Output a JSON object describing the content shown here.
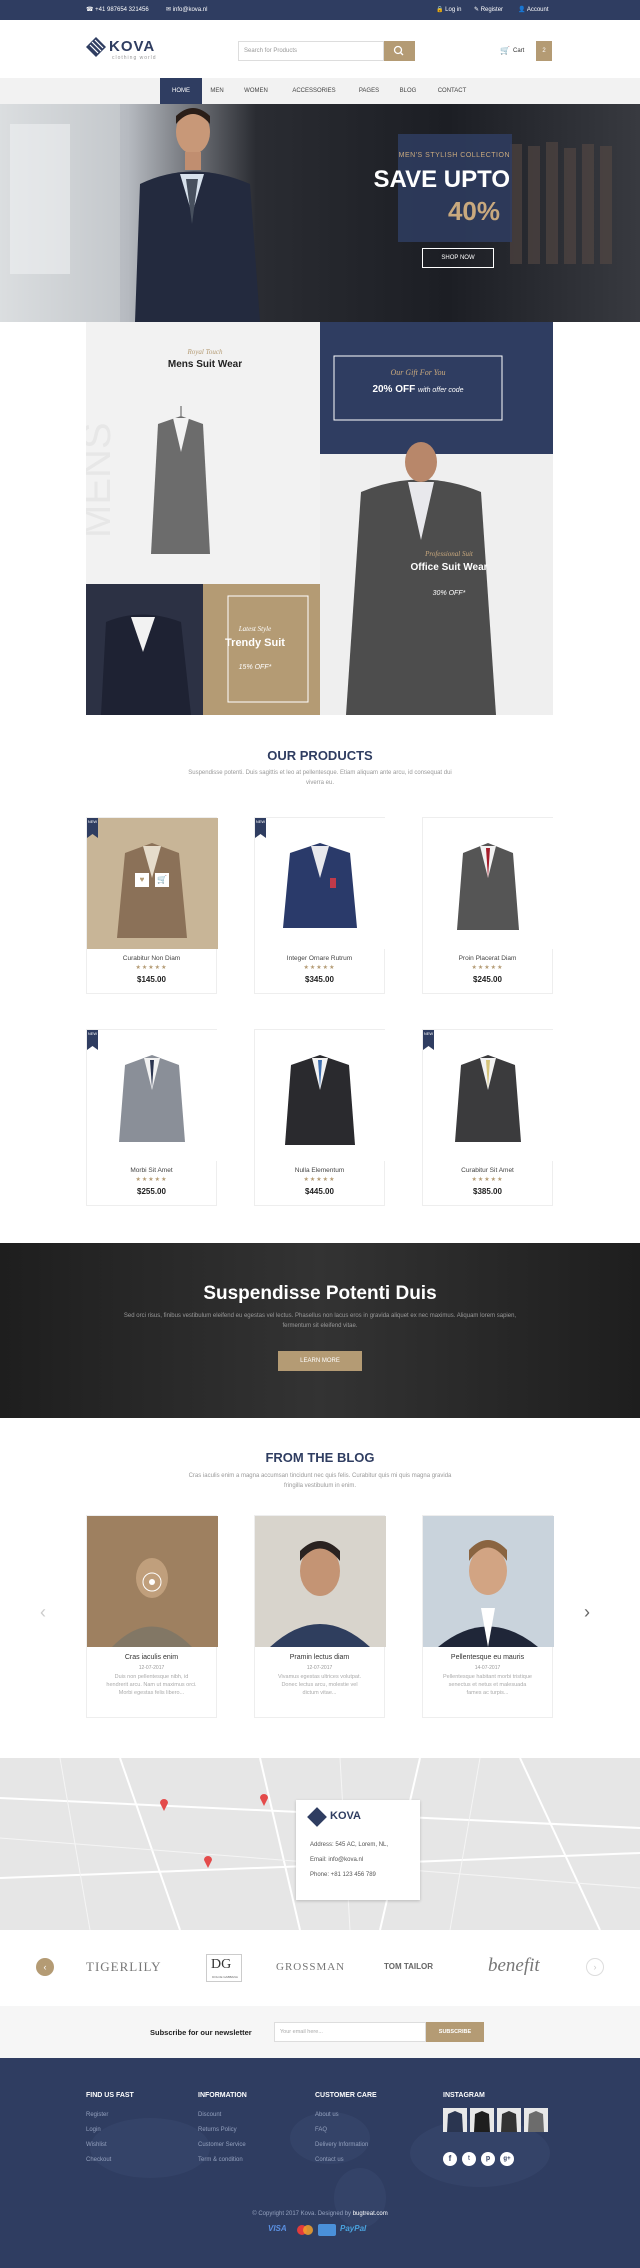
{
  "topbar": {
    "phone": "+41 987654 321456",
    "email": "info@kova.nl",
    "login": "Log in",
    "register": "Register",
    "account": "Account"
  },
  "header": {
    "logo": "KOVA",
    "logo_tag": "clothing world",
    "search_placeholder": "Search for Products",
    "cart_label": "Cart",
    "cart_count": "2"
  },
  "nav": [
    "HOME",
    "MEN",
    "WOMEN",
    "ACCESSORIES",
    "PAGES",
    "BLOG",
    "CONTACT"
  ],
  "hero": {
    "eyebrow": "MEN'S STYLISH COLLECTION",
    "title": "SAVE UPTO",
    "percent": "40%",
    "button": "SHOP NOW"
  },
  "promo": {
    "royal_script": "Royal Touch",
    "royal_title": "Mens Suit Wear",
    "gift_script": "Our Gift For You",
    "gift_off": "20% OFF",
    "gift_rest": "with offer code",
    "pro_script": "Professional Suit",
    "pro_title": "Office Suit Wear",
    "pro_off": "30% OFF*",
    "latest_script": "Latest Style",
    "latest_title": "Trendy Suit",
    "latest_off": "15% OFF*"
  },
  "products": {
    "title": "OUR PRODUCTS",
    "subtitle": "Suspendisse potenti. Duis sagittis et leo at pellentesque. Etiam aliquam ante arcu, id consequat dui viverra eu.",
    "ribbon": "NEW",
    "items": [
      {
        "name": "Curabitur Non Diam",
        "stars": "★★★★★",
        "price": "$145.00"
      },
      {
        "name": "Integer Ornare Rutrum",
        "stars": "★★★★★",
        "price": "$345.00"
      },
      {
        "name": "Proin Placerat Diam",
        "stars": "★★★★★",
        "price": "$245.00"
      },
      {
        "name": "Morbi Sit Amet",
        "stars": "★★★★★",
        "price": "$255.00"
      },
      {
        "name": "Nulla Elementum",
        "stars": "★★★★★",
        "price": "$445.00"
      },
      {
        "name": "Curabitur Sit Amet",
        "stars": "★★★★★",
        "price": "$385.00"
      }
    ]
  },
  "banner": {
    "title": "Suspendisse Potenti Duis",
    "text": "Sed orci risus, finibus vestibulum eleifend eu egestas vel lectus. Phasellus non lacus eros in gravida aliquet ex nec maximus. Aliquam lorem sapien, fermentum sit eleifend vitae.",
    "button": "LEARN MORE"
  },
  "blog": {
    "title": "FROM THE BLOG",
    "subtitle": "Cras iaculis enim a magna accumsan tincidunt nec quis felis. Curabitur quis mi quis magna gravida fringilla vestibulum in enim.",
    "items": [
      {
        "title": "Cras iaculis enim",
        "date": "12-07-2017",
        "excerpt": "Duis non pellentesque nibh, id hendrerit arcu. Nam ut maximus orci. Morbi egestas felis libero..."
      },
      {
        "title": "Pramin lectus diam",
        "date": "12-07-2017",
        "excerpt": "Vivamus egestas ultrices volutpat. Donec lectus arcu, molestie vel dictum vitae..."
      },
      {
        "title": "Pellentesque eu mauris",
        "date": "14-07-2017",
        "excerpt": "Pellentesque habitant morbi tristique senectus et netus et malesuada fames ac turpis..."
      }
    ]
  },
  "map": {
    "logo": "KOVA",
    "address": "Address: 545 AC, Lorem, NL,",
    "email": "Email: info@kova.nl",
    "phone": "Phone: +81 123 456 789"
  },
  "brands": [
    "TIGERLILY",
    "DOLCE GABBANA",
    "GROSSMAN",
    "TOM TAILOR",
    "benefit"
  ],
  "newsletter": {
    "label": "Subscribe for our newsletter",
    "placeholder": "Your email here...",
    "button": "SUBSCRIBE"
  },
  "footer": {
    "col1": {
      "title": "FIND US FAST",
      "links": [
        "Register",
        "Login",
        "Wishlist",
        "Checkout"
      ]
    },
    "col2": {
      "title": "INFORMATION",
      "links": [
        "Discount",
        "Returns Policy",
        "Customer Service",
        "Term & condition"
      ]
    },
    "col3": {
      "title": "CUSTOMER CARE",
      "links": [
        "About us",
        "FAQ",
        "Delivery Information",
        "Contact us"
      ]
    },
    "col4": {
      "title": "INSTAGRAM"
    },
    "copyright": "© Copyright 2017 Kova. Designed by",
    "designer": "bugtreat.com",
    "payments": [
      "VISA",
      "PayPal"
    ]
  },
  "colors": {
    "navy": "#2f3d61",
    "gold": "#b49b74"
  }
}
